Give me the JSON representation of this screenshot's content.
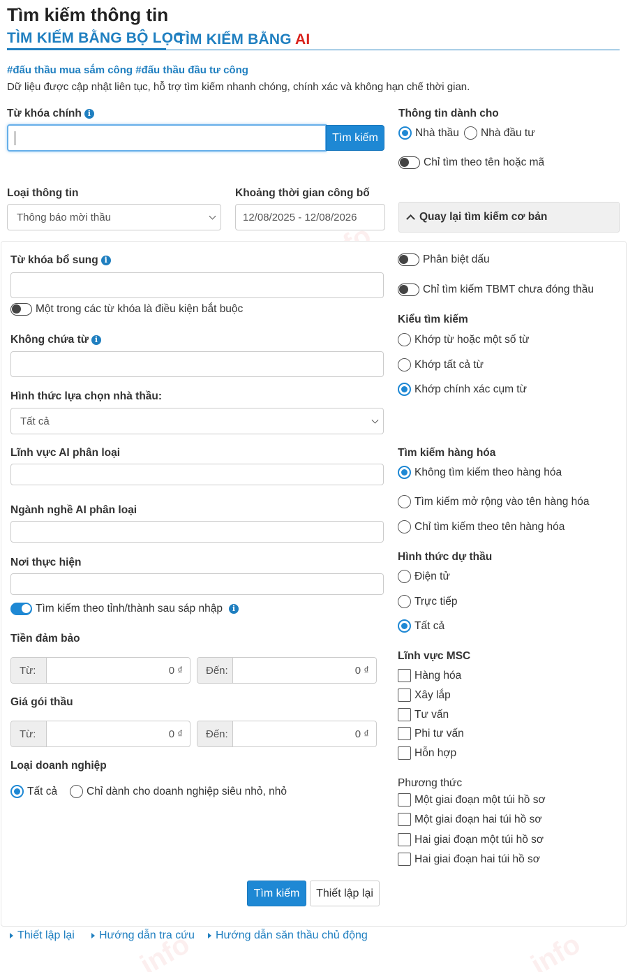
{
  "page": {
    "title": "Tìm kiếm thông tin"
  },
  "tabs": {
    "filter": "TÌM KIẾM BẰNG BỘ LỌC",
    "ai_prefix": "TÌM KIẾM BẰNG ",
    "ai_suffix": "AI"
  },
  "intro": {
    "hashtags": "#đấu thầu mua sắm công #đấu thầu đầu tư công",
    "description": "Dữ liệu được cập nhật liên tục, hỗ trợ tìm kiếm nhanh chóng, chính xác và không hạn chế thời gian."
  },
  "main_keyword": {
    "label": "Từ khóa chính",
    "value": "",
    "search_button": "Tìm kiếm"
  },
  "info_for": {
    "label": "Thông tin dành cho",
    "options": [
      "Nhà thầu",
      "Nhà đầu tư"
    ],
    "selected": "Nhà thầu"
  },
  "toggle_name_code": {
    "label": "Chỉ tìm theo tên hoặc mã",
    "on": false
  },
  "info_type": {
    "label": "Loại thông tin",
    "value": "Thông báo mời thầu"
  },
  "publish_period": {
    "label": "Khoảng thời gian công bố",
    "value": "12/08/2025 - 12/08/2026"
  },
  "back_basic": {
    "label": "Quay lại tìm kiếm cơ bản"
  },
  "extra_keyword": {
    "label": "Từ khóa bổ sung",
    "value": ""
  },
  "toggle_any_keyword": {
    "label": "Một trong các từ khóa là điều kiện bắt buộc",
    "on": false
  },
  "exclude_words": {
    "label": "Không chứa từ",
    "value": ""
  },
  "selection_method": {
    "label": "Hình thức lựa chọn nhà thầu:",
    "value": "Tất cả"
  },
  "ai_field": {
    "label": "Lĩnh vực AI phân loại",
    "value": ""
  },
  "ai_industry": {
    "label": "Ngành nghề AI phân loại",
    "value": ""
  },
  "location": {
    "label": "Nơi thực hiện",
    "value": ""
  },
  "toggle_province": {
    "label": "Tìm kiếm theo tỉnh/thành sau sáp nhập",
    "on": true
  },
  "deposit": {
    "label": "Tiền đảm bảo",
    "from_label": "Từ:",
    "from_value": "0 ₫",
    "to_label": "Đến:",
    "to_value": "0 ₫"
  },
  "package_price": {
    "label": "Giá gói thầu",
    "from_label": "Từ:",
    "from_value": "0 ₫",
    "to_label": "Đến:",
    "to_value": "0 ₫"
  },
  "enterprise_type": {
    "label": "Loại doanh nghiệp",
    "options": [
      "Tất cả",
      "Chỉ dành cho doanh nghiệp siêu nhỏ, nhỏ"
    ],
    "selected": "Tất cả"
  },
  "toggle_diacritics": {
    "label": "Phân biệt dấu",
    "on": false
  },
  "toggle_open_only": {
    "label": "Chỉ tìm kiếm TBMT chưa đóng thầu",
    "on": false
  },
  "search_type": {
    "label": "Kiểu tìm kiếm",
    "options": [
      "Khớp từ hoặc một số từ",
      "Khớp tất cả từ",
      "Khớp chính xác cụm từ"
    ],
    "selected": "Khớp chính xác cụm từ"
  },
  "goods_search": {
    "label": "Tìm kiếm hàng hóa",
    "options": [
      "Không tìm kiếm theo hàng hóa",
      "Tìm kiếm mở rộng vào tên hàng hóa",
      "Chỉ tìm kiếm theo tên hàng hóa"
    ],
    "selected": "Không tìm kiếm theo hàng hóa"
  },
  "bid_form": {
    "label": "Hình thức dự thầu",
    "options": [
      "Điện tử",
      "Trực tiếp",
      "Tất cả"
    ],
    "selected": "Tất cả"
  },
  "msc_field": {
    "label": "Lĩnh vực MSC",
    "options": [
      "Hàng hóa",
      "Xây lắp",
      "Tư vấn",
      "Phi tư vấn",
      "Hỗn hợp"
    ]
  },
  "method": {
    "label": "Phương thức",
    "options": [
      "Một giai đoạn một túi hồ sơ",
      "Một giai đoạn hai túi hồ sơ",
      "Hai giai đoạn một túi hồ sơ",
      "Hai giai đoạn hai túi hồ sơ"
    ]
  },
  "actions": {
    "search": "Tìm kiếm",
    "reset": "Thiết lập lại"
  },
  "footer_links": [
    "Thiết lập lại",
    "Hướng dẫn tra cứu",
    "Hướng dẫn săn thầu chủ động"
  ],
  "colors": {
    "primary": "#1e88d4",
    "link": "#1f7fc0",
    "ai_red": "#d9221c"
  }
}
